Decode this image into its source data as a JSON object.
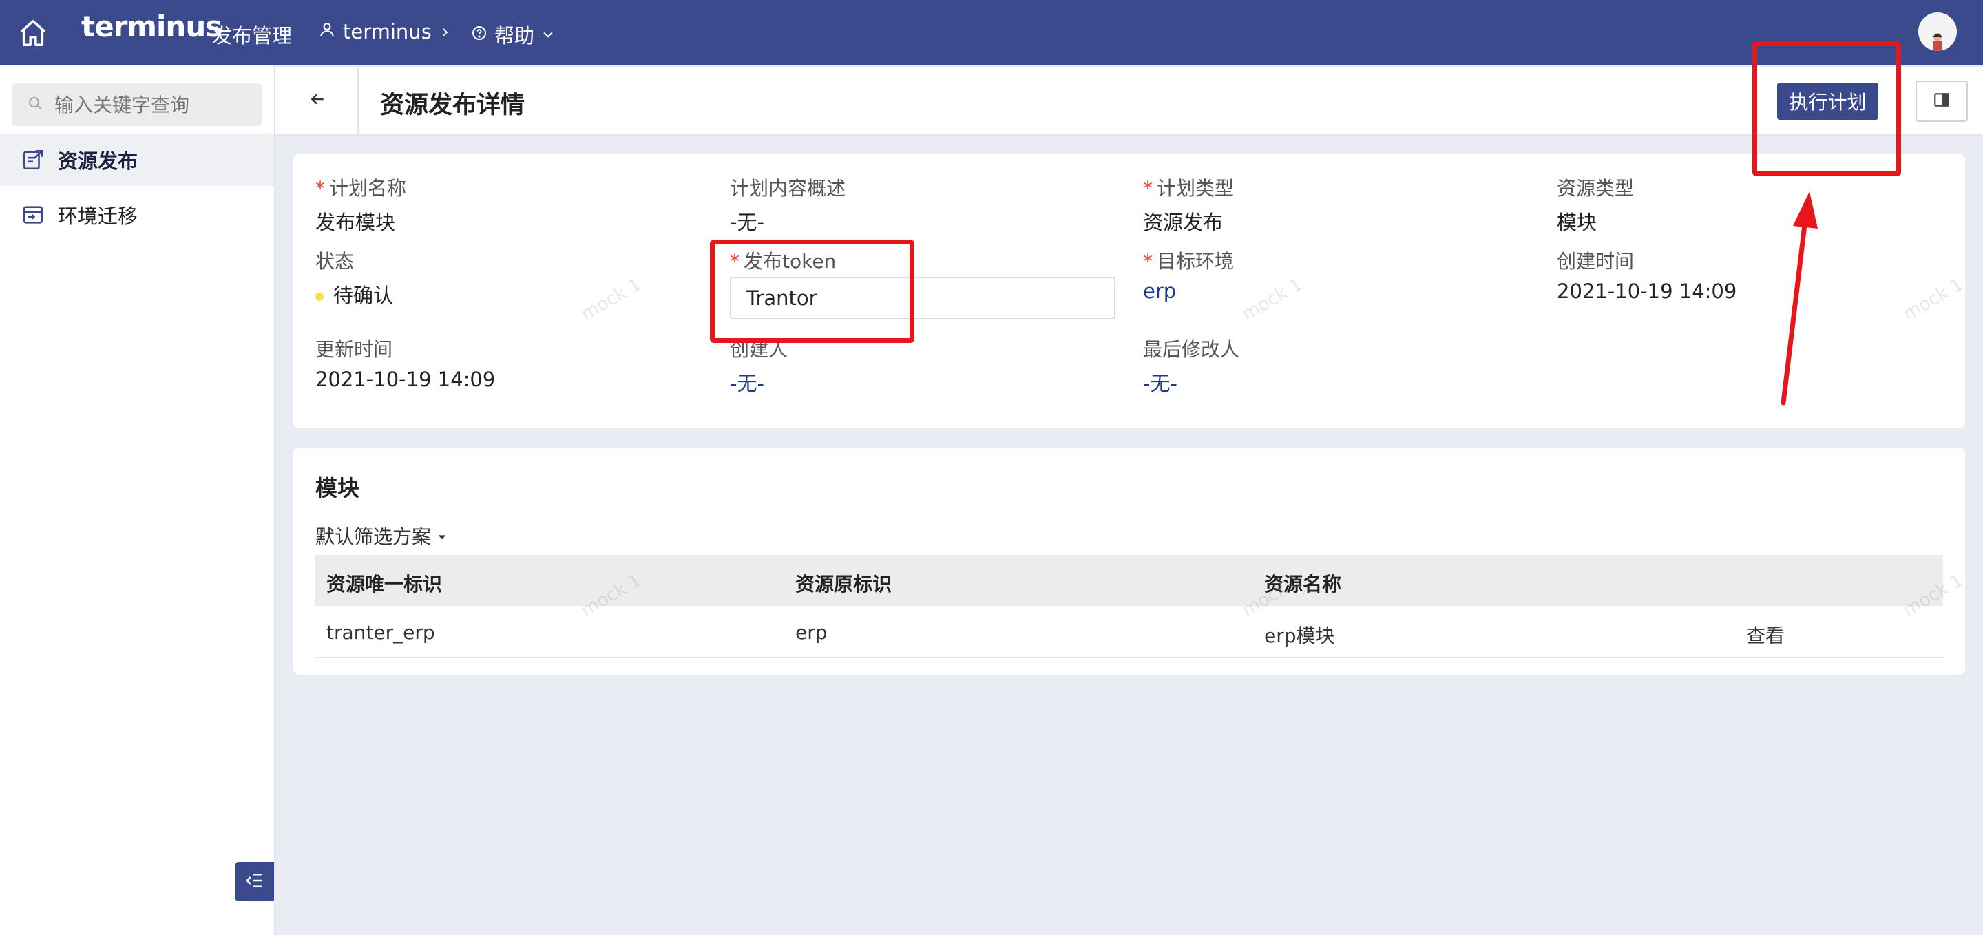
{
  "topbar": {
    "brand": "terminus",
    "app_title": "发布管理",
    "user": "terminus",
    "help": "帮助"
  },
  "sidebar": {
    "search_placeholder": "输入关键字查询",
    "items": [
      {
        "label": "资源发布",
        "icon": "publish-icon",
        "active": true
      },
      {
        "label": "环境迁移",
        "icon": "migrate-icon",
        "active": false
      }
    ]
  },
  "header": {
    "title": "资源发布详情",
    "execute_button": "执行计划"
  },
  "detail": {
    "plan_name_label": "计划名称",
    "plan_name": "发布模块",
    "plan_desc_label": "计划内容概述",
    "plan_desc": "-无-",
    "plan_type_label": "计划类型",
    "plan_type": "资源发布",
    "resource_type_label": "资源类型",
    "resource_type": "模块",
    "status_label": "状态",
    "status": "待确认",
    "token_label": "发布token",
    "token_value": "Trantor",
    "target_env_label": "目标环境",
    "target_env": "erp",
    "created_time_label": "创建时间",
    "created_time": "2021-10-19 14:09",
    "updated_time_label": "更新时间",
    "updated_time": "2021-10-19 14:09",
    "creator_label": "创建人",
    "creator": "-无-",
    "last_modifier_label": "最后修改人",
    "last_modifier": "-无-"
  },
  "modules": {
    "title": "模块",
    "filter_label": "默认筛选方案",
    "columns": [
      "资源唯一标识",
      "资源原标识",
      "资源名称"
    ],
    "rows": [
      {
        "uid": "tranter_erp",
        "origin": "erp",
        "name": "erp模块",
        "action": "查看"
      }
    ]
  },
  "watermark": "mock 1",
  "colors": {
    "nav": "#3a4a8c",
    "required": "#e8432a",
    "link": "#1d3a8f",
    "status_dot": "#f2e63a",
    "annotation": "#e8161b"
  }
}
